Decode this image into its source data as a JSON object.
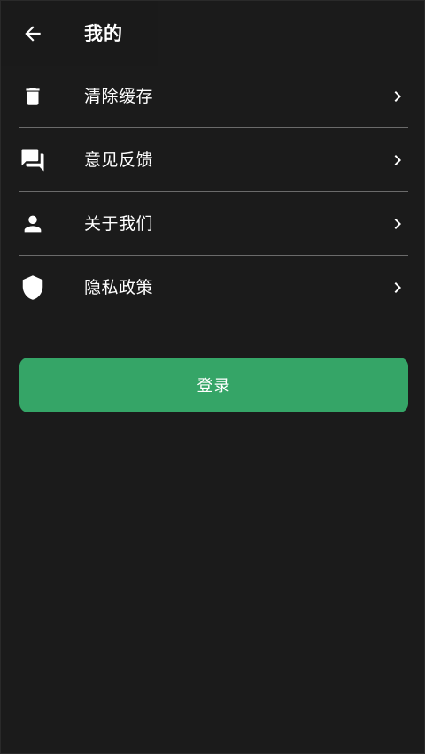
{
  "header": {
    "title": "我的",
    "back_icon": "arrow-left-icon"
  },
  "menu": {
    "items": [
      {
        "label": "清除缓存",
        "icon": "trash-icon"
      },
      {
        "label": "意见反馈",
        "icon": "chat-bubbles-icon"
      },
      {
        "label": "关于我们",
        "icon": "person-icon"
      },
      {
        "label": "隐私政策",
        "icon": "shield-icon"
      }
    ],
    "chevron_icon": "chevron-right-icon"
  },
  "login": {
    "label": "登录"
  },
  "colors": {
    "background": "#1b1b1b",
    "accent": "#35a567",
    "divider": "#6b6b6b",
    "text": "#ffffff"
  }
}
